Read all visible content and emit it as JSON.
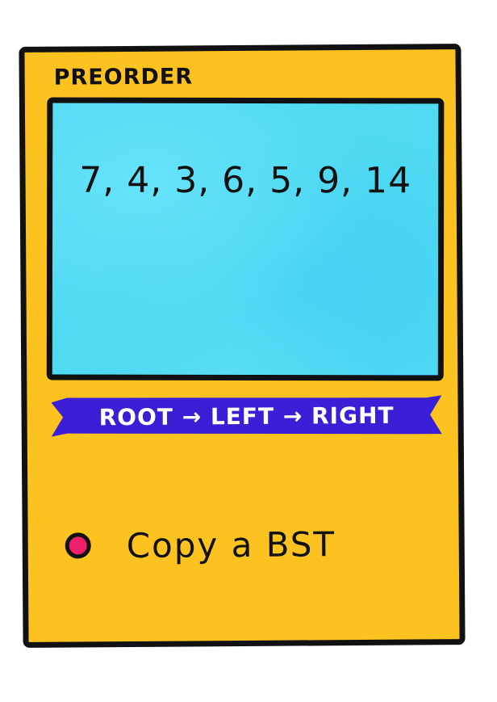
{
  "card": {
    "title": "PREORDER",
    "sequence": "7, 4, 3, 6, 5, 9, 14",
    "banner": "ROOT → LEFT → RIGHT",
    "use_case": "Copy a BST"
  },
  "colors": {
    "card_background": "#fcc21f",
    "screen_background": "#4fd9f2",
    "banner_background": "#3b1fd6",
    "bullet": "#ef1f6b",
    "outline": "#111111"
  }
}
